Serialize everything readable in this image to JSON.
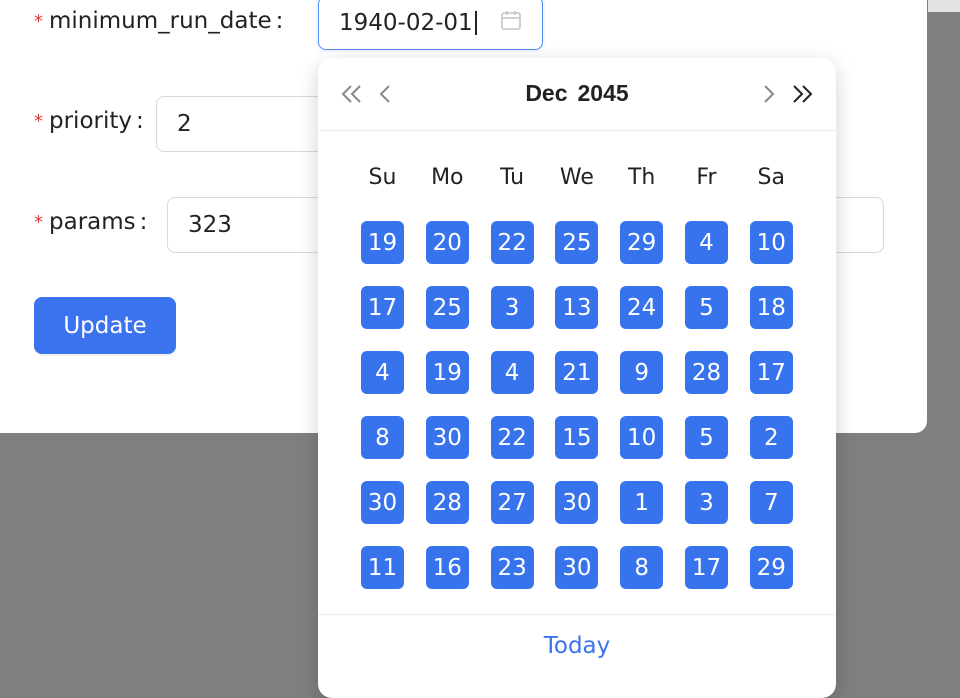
{
  "form": {
    "fields": [
      {
        "key": "minimum_run_date",
        "label": "minimum_run_date",
        "value": "1940-02-01",
        "required": true
      },
      {
        "key": "priority",
        "label": "priority",
        "value": "2",
        "required": true
      },
      {
        "key": "params",
        "label": "params",
        "value": "323",
        "required": true
      }
    ],
    "required_mark": "*",
    "colon": ":",
    "update_label": "Update"
  },
  "datepicker": {
    "month": "Dec",
    "year": "2045",
    "weekdays": [
      "Su",
      "Mo",
      "Tu",
      "We",
      "Th",
      "Fr",
      "Sa"
    ],
    "days": [
      [
        "19",
        "20",
        "22",
        "25",
        "29",
        "4",
        "10"
      ],
      [
        "17",
        "25",
        "3",
        "13",
        "24",
        "5",
        "18"
      ],
      [
        "4",
        "19",
        "4",
        "21",
        "9",
        "28",
        "17"
      ],
      [
        "8",
        "30",
        "22",
        "15",
        "10",
        "5",
        "2"
      ],
      [
        "30",
        "28",
        "27",
        "30",
        "1",
        "3",
        "7"
      ],
      [
        "11",
        "16",
        "23",
        "30",
        "8",
        "17",
        "29"
      ]
    ],
    "today_label": "Today",
    "icons": [
      "double-left-icon",
      "left-icon",
      "right-icon",
      "double-right-icon",
      "calendar-icon"
    ]
  },
  "colors": {
    "accent": "#3b73ef",
    "required": "#e03b3b",
    "backdrop": "#7f7f7f"
  }
}
